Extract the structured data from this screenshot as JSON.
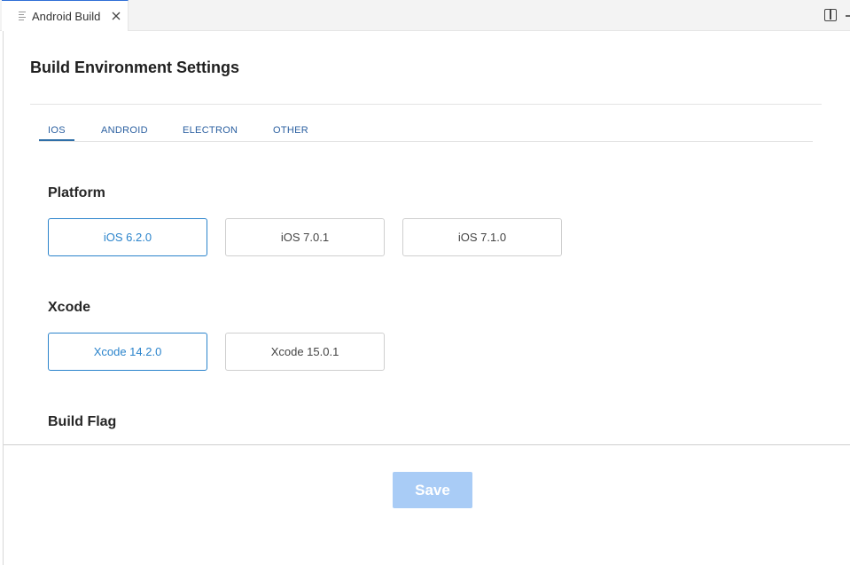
{
  "editor": {
    "tab_title": "Android Build"
  },
  "settings": {
    "title": "Build Environment Settings",
    "tabs": [
      {
        "label": "IOS"
      },
      {
        "label": "ANDROID"
      },
      {
        "label": "ELECTRON"
      },
      {
        "label": "OTHER"
      }
    ],
    "active_tab": "IOS",
    "platform": {
      "label": "Platform",
      "options": [
        "iOS 6.2.0",
        "iOS 7.0.1",
        "iOS 7.1.0"
      ],
      "selected": "iOS 6.2.0"
    },
    "xcode": {
      "label": "Xcode",
      "options": [
        "Xcode 14.2.0",
        "Xcode 15.0.1"
      ],
      "selected": "Xcode 14.2.0"
    },
    "build_flag": {
      "label": "Build Flag"
    }
  },
  "actions": {
    "save_label": "Save"
  },
  "colors": {
    "accent": "#2b84cc",
    "tab_text": "#2a5fa0",
    "save_disabled_bg": "#a9ccf6"
  }
}
